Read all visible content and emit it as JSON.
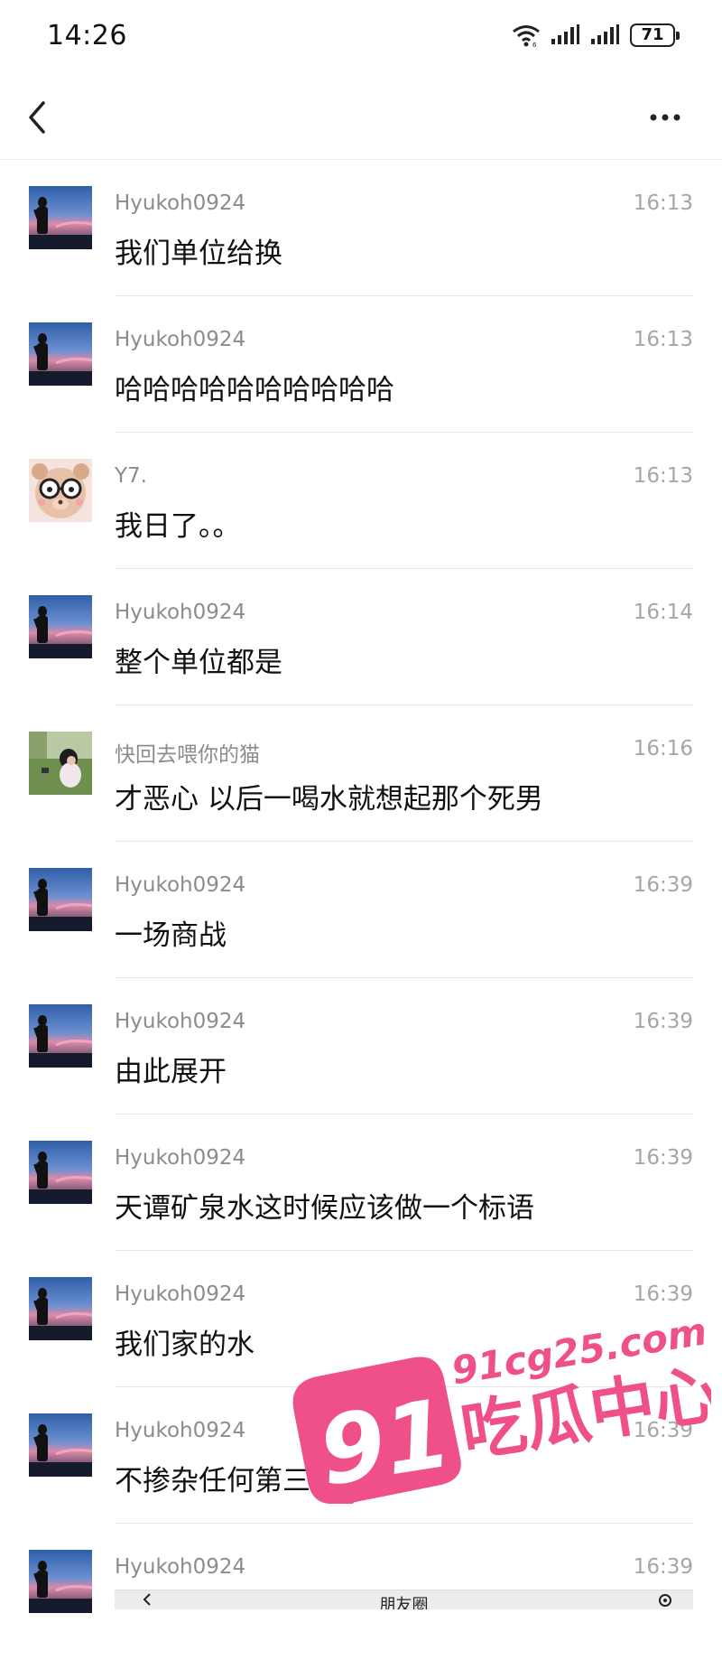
{
  "status_bar": {
    "time": "14:26",
    "battery": "71",
    "icons": [
      "wifi-icon",
      "signal-icon",
      "signal-icon",
      "battery-icon"
    ]
  },
  "header": {
    "back_icon": "chevron-left-icon",
    "more_icon": "more-dots-icon"
  },
  "messages": [
    {
      "sender": "Hyukoh0924",
      "time": "16:13",
      "text": "我们单位给换",
      "avatar": "sunset-silhouette"
    },
    {
      "sender": "Hyukoh0924",
      "time": "16:13",
      "text": "哈哈哈哈哈哈哈哈哈哈",
      "avatar": "sunset-silhouette"
    },
    {
      "sender": "Y7.",
      "time": "16:13",
      "text": "我日了。。",
      "avatar": "plush-bear-glasses"
    },
    {
      "sender": "Hyukoh0924",
      "time": "16:14",
      "text": "整个单位都是",
      "avatar": "sunset-silhouette"
    },
    {
      "sender": "快回去喂你的猫",
      "time": "16:16",
      "text": "才恶心 以后一喝水就想起那个死男",
      "avatar": "girl-on-grass"
    },
    {
      "sender": "Hyukoh0924",
      "time": "16:39",
      "text": "一场商战",
      "avatar": "sunset-silhouette"
    },
    {
      "sender": "Hyukoh0924",
      "time": "16:39",
      "text": "由此展开",
      "avatar": "sunset-silhouette"
    },
    {
      "sender": "Hyukoh0924",
      "time": "16:39",
      "text": "天谭矿泉水这时候应该做一个标语",
      "avatar": "sunset-silhouette"
    },
    {
      "sender": "Hyukoh0924",
      "time": "16:39",
      "text": "我们家的水",
      "avatar": "sunset-silhouette"
    },
    {
      "sender": "Hyukoh0924",
      "time": "16:39",
      "text": "不掺杂任何第三者哦",
      "avatar": "sunset-silhouette"
    },
    {
      "sender": "Hyukoh0924",
      "time": "16:39",
      "text": "",
      "avatar": "sunset-silhouette"
    }
  ],
  "bottom_strip": {
    "title": "朋友圈"
  },
  "watermark": {
    "number": "91",
    "domain": "91cg25.com",
    "slogan": "吃瓜中心",
    "color": "#f0508a"
  }
}
